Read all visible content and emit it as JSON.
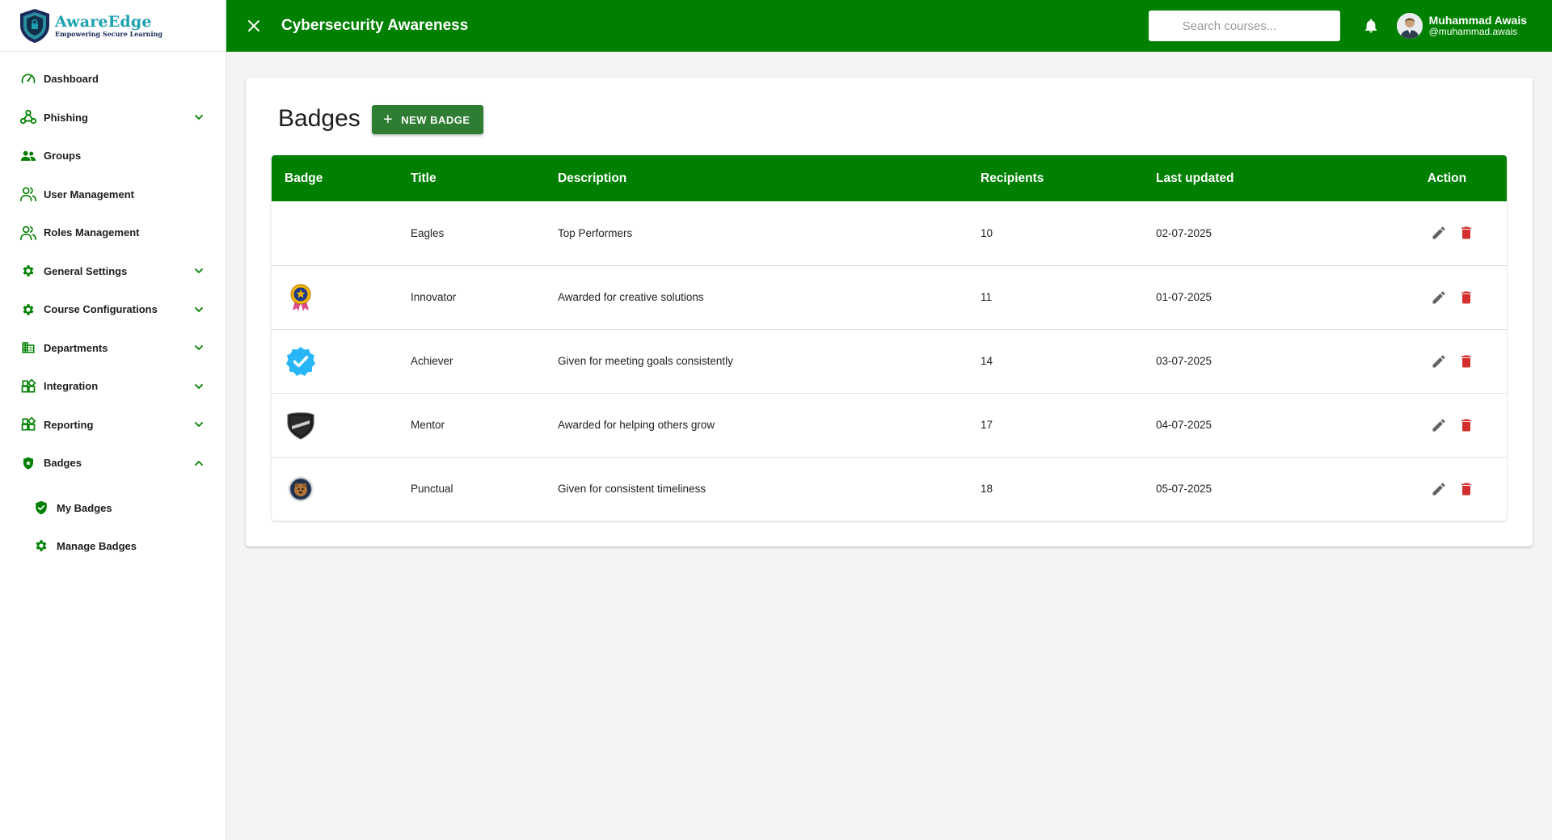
{
  "brand": {
    "name": "AwareEdge",
    "tagline": "Empowering Secure Learning"
  },
  "colors": {
    "primary": "#008000",
    "button": "#2e7d32",
    "delete": "#d32f2f",
    "edit": "#616161",
    "brand_text": "#1aa2b0"
  },
  "sidebar": {
    "items": [
      {
        "label": "Dashboard",
        "icon": "speedometer-icon",
        "chevron": false
      },
      {
        "label": "Phishing",
        "icon": "webhook-icon",
        "chevron": "down"
      },
      {
        "label": "Groups",
        "icon": "people-icon",
        "chevron": false
      },
      {
        "label": "User Management",
        "icon": "users-outline-icon",
        "chevron": false
      },
      {
        "label": "Roles Management",
        "icon": "users-outline-icon",
        "chevron": false
      },
      {
        "label": "General Settings",
        "icon": "gear-icon",
        "chevron": "down"
      },
      {
        "label": "Course Configurations",
        "icon": "gear-icon",
        "chevron": "down"
      },
      {
        "label": "Departments",
        "icon": "building-icon",
        "chevron": "down"
      },
      {
        "label": "Integration",
        "icon": "widgets-icon",
        "chevron": "down"
      },
      {
        "label": "Reporting",
        "icon": "widgets-icon",
        "chevron": "down"
      },
      {
        "label": "Badges",
        "icon": "shield-star-icon",
        "chevron": "up"
      }
    ],
    "sub_items": [
      {
        "label": "My Badges",
        "icon": "verified-shield-icon"
      },
      {
        "label": "Manage Badges",
        "icon": "gear-icon"
      }
    ]
  },
  "topbar": {
    "title": "Cybersecurity Awareness",
    "search_placeholder": "Search courses...",
    "user_name": "Muhammad Awais",
    "user_handle": "@muhammad.awais"
  },
  "main": {
    "page_title": "Badges",
    "new_button_label": "NEW BADGE",
    "table": {
      "headers": [
        "Badge",
        "Title",
        "Description",
        "Recipients",
        "Last updated",
        "Action"
      ],
      "rows": [
        {
          "badge_icon": "none",
          "title": "Eagles",
          "description": "Top Performers",
          "recipients": "10",
          "last_updated": "02-07-2025"
        },
        {
          "badge_icon": "star-medal-icon",
          "title": "Innovator",
          "description": "Awarded for creative solutions",
          "recipients": "11",
          "last_updated": "01-07-2025"
        },
        {
          "badge_icon": "verified-check-icon",
          "title": "Achiever",
          "description": "Given for meeting goals consistently",
          "recipients": "14",
          "last_updated": "03-07-2025"
        },
        {
          "badge_icon": "mentor-shield-icon",
          "title": "Mentor",
          "description": "Awarded for helping others grow",
          "recipients": "17",
          "last_updated": "04-07-2025"
        },
        {
          "badge_icon": "punctual-emblem-icon",
          "title": "Punctual",
          "description": "Given for consistent timeliness",
          "recipients": "18",
          "last_updated": "05-07-2025"
        }
      ]
    }
  }
}
